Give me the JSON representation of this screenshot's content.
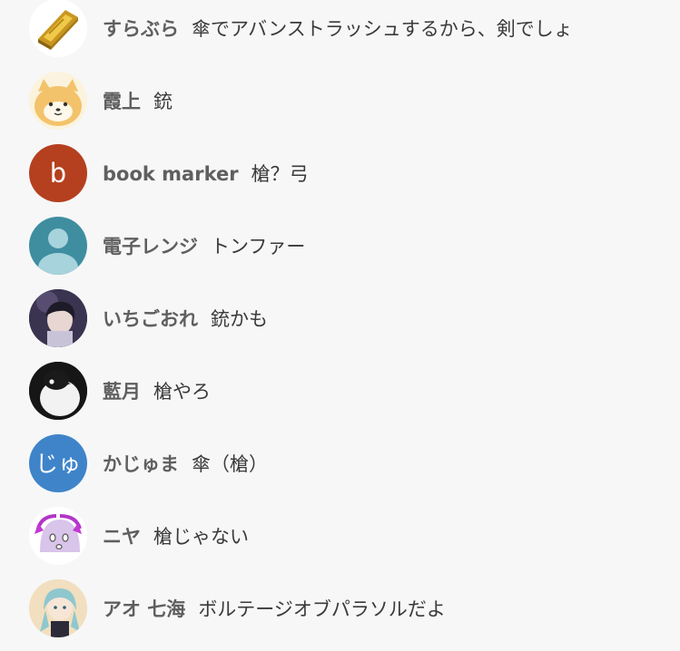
{
  "comments": [
    {
      "name": "すらぶら",
      "message": "傘でアバンストラッシュするから、剣でしょ",
      "avatar": {
        "type": "image",
        "icon": "gold-bar-icon"
      }
    },
    {
      "name": "霞上",
      "message": "銃",
      "avatar": {
        "type": "image",
        "icon": "shiba-dog-icon"
      }
    },
    {
      "name": "book marker",
      "message": "槍？弓",
      "avatar": {
        "type": "letter",
        "text": "b",
        "color": "#b5401f"
      }
    },
    {
      "name": "電子レンジ",
      "message": "トンファー",
      "avatar": {
        "type": "image",
        "icon": "default-person-icon",
        "color": "#3e8ea0"
      }
    },
    {
      "name": "いちごおれ",
      "message": "銃かも",
      "avatar": {
        "type": "image",
        "icon": "anime-boy-icon"
      }
    },
    {
      "name": "藍月",
      "message": "槍やろ",
      "avatar": {
        "type": "image",
        "icon": "penguin-plush-icon"
      }
    },
    {
      "name": "かじゅま",
      "message": "傘（槍）",
      "avatar": {
        "type": "letter",
        "text": "じゅ",
        "color": "#3f84c9"
      }
    },
    {
      "name": "ニヤ",
      "message": "槍じゃない",
      "avatar": {
        "type": "image",
        "icon": "purple-ghost-icon"
      }
    },
    {
      "name": "アオ 七海",
      "message": "ボルテージオブパラソルだよ",
      "avatar": {
        "type": "image",
        "icon": "anime-girl-icon"
      }
    }
  ]
}
